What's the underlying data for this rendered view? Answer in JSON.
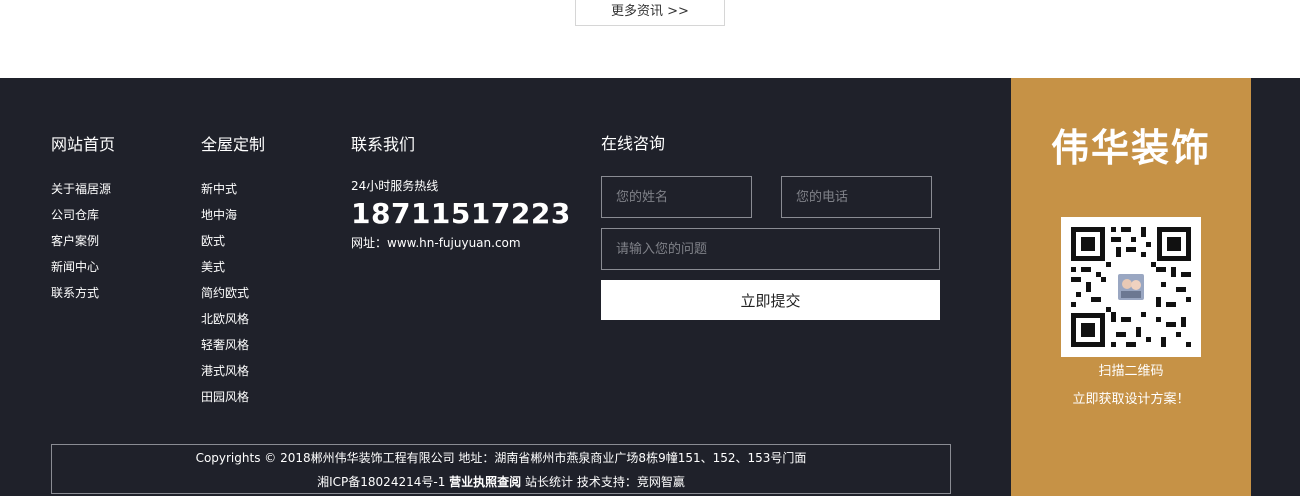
{
  "more_button": "更多资讯 >>",
  "footer": {
    "nav1": {
      "title": "网站首页",
      "items": [
        "关于福居源",
        "公司仓库",
        "客户案例",
        "新闻中心",
        "联系方式"
      ]
    },
    "nav2": {
      "title": "全屋定制",
      "items": [
        "新中式",
        "地中海",
        "欧式",
        "美式",
        "简约欧式",
        "北欧风格",
        "轻奢风格",
        "港式风格",
        "田园风格"
      ]
    },
    "contact": {
      "title": "联系我们",
      "hotline_label": "24小时服务热线",
      "hotline": "18711517223",
      "address": "网址：www.hn-fujuyuan.com"
    },
    "consult": {
      "title": "在线咨询",
      "name_placeholder": "您的姓名",
      "phone_placeholder": "您的电话",
      "question_placeholder": "请输入您的问题",
      "submit_label": "立即提交"
    },
    "copyright": {
      "line1": "Copyrights © 2018郴州伟华装饰工程有限公司 地址：湖南省郴州市燕泉商业广场8栋9幢151、152、153号门面",
      "icp": "湘ICP备18024214号-1",
      "license": "营业执照查阅",
      "stats": "站长统计",
      "support": "技术支持：竞网智赢"
    },
    "brand": {
      "name": "伟华装饰",
      "scan": "扫描二维码",
      "cta": "立即获取设计方案！"
    }
  },
  "colors": {
    "footer_bg": "#1f212a",
    "brand_bg": "#c69246"
  },
  "icons": {
    "qr": "qr-code-icon"
  }
}
